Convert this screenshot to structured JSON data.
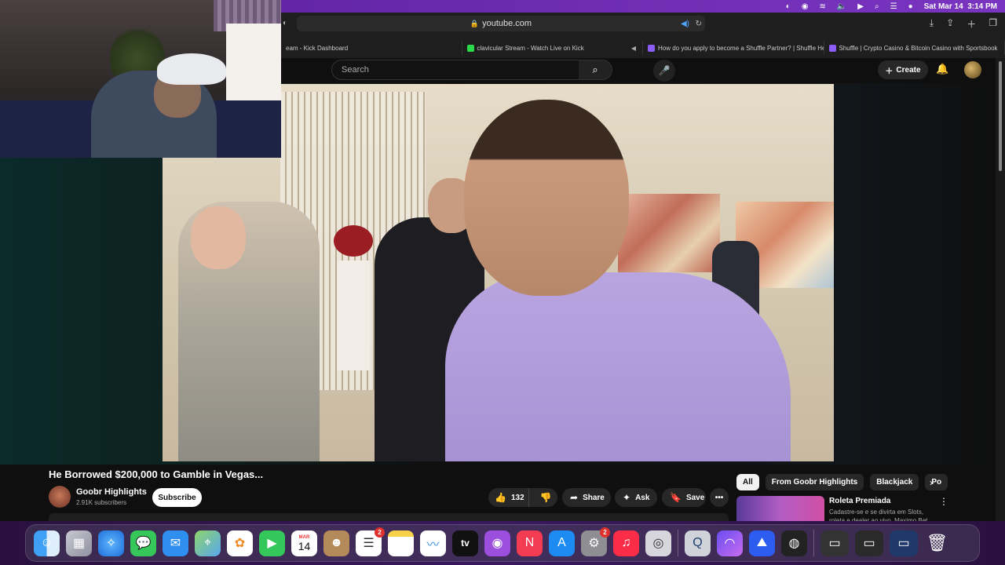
{
  "menubar": {
    "date": "Sat Mar 14",
    "time": "3:14 PM"
  },
  "safari": {
    "url": "youtube.com",
    "tabs": [
      {
        "label": "eam - Kick Dashboard",
        "color": "#2bd94d"
      },
      {
        "label": "clavicular Stream - Watch Live on Kick",
        "color": "#2bd94d"
      },
      {
        "label": "How do you apply to become a Shuffle Partner? | Shuffle He...",
        "color": "#8b5cf6"
      },
      {
        "label": "Shuffle | Crypto Casino & Bitcoin Casino with Sportsbook",
        "color": "#8b5cf6"
      }
    ]
  },
  "youtube": {
    "search_placeholder": "Search",
    "create_label": "Create"
  },
  "video": {
    "title": "He Borrowed $200,000 to Gamble in Vegas...",
    "channel": "Goobr Highlights",
    "subscribers": "2.91K subscribers",
    "subscribe_label": "Subscribe",
    "likes": "132",
    "share_label": "Share",
    "ask_label": "Ask",
    "save_label": "Save"
  },
  "chips": [
    "All",
    "From Goobr Highlights",
    "Blackjack",
    "Po"
  ],
  "recommendation": {
    "title": "Roleta Premiada",
    "description": "Cadastre-se e se divirta em Slots, roleta e dealer ao vivo. Maximo Bet"
  },
  "dock": {
    "calendar_month": "MAR",
    "calendar_day": "14",
    "reminders_badge": "2",
    "settings_badge": "2",
    "tv_label": "tv",
    "apps": [
      "finder-icon",
      "launchpad-icon",
      "safari-icon",
      "messages-icon",
      "mail-icon",
      "maps-icon",
      "photos-icon",
      "facetime-icon",
      "calendar-icon",
      "contacts-icon",
      "reminders-icon",
      "notes-icon",
      "freeform-icon",
      "tv-icon",
      "podcasts-icon",
      "news-icon",
      "appstore-icon",
      "settings-icon",
      "music-icon",
      "disk-utility-icon",
      "quicktime-icon",
      "arc-icon",
      "nordvpn-icon",
      "obs-icon",
      "trash-icon"
    ]
  }
}
